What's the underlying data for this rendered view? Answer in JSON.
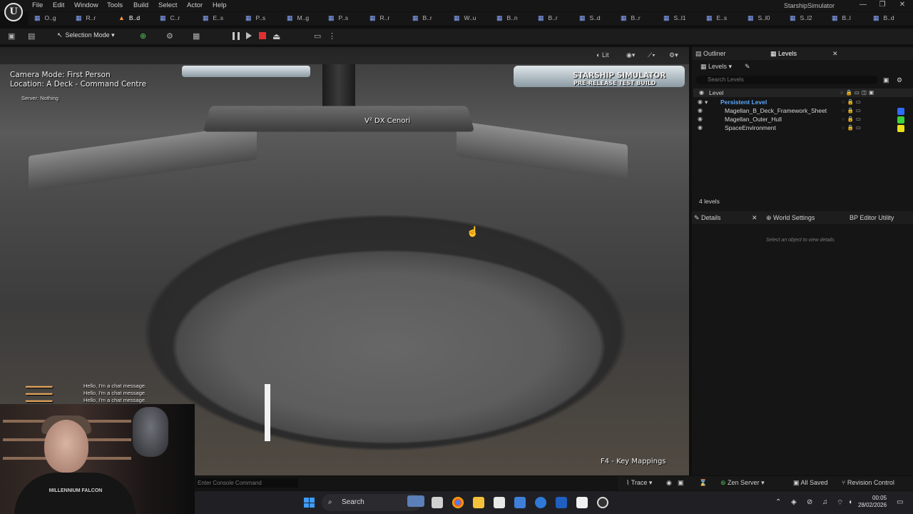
{
  "app": {
    "title": "StarshipSimulator",
    "logo_letter": "U"
  },
  "menu": [
    "File",
    "Edit",
    "Window",
    "Tools",
    "Build",
    "Select",
    "Actor",
    "Help"
  ],
  "window_controls": {
    "minimize": "—",
    "maximize": "❐",
    "close": "✕"
  },
  "tabs": [
    {
      "label": "O..g",
      "icon": "▦"
    },
    {
      "label": "R..r",
      "icon": "▦"
    },
    {
      "label": "B..d",
      "icon": "▲"
    },
    {
      "label": "C..r",
      "icon": "▦"
    },
    {
      "label": "E..s",
      "icon": "▦"
    },
    {
      "label": "P..s",
      "icon": "▦"
    },
    {
      "label": "M..g",
      "icon": "▦"
    },
    {
      "label": "P..s",
      "icon": "▦"
    },
    {
      "label": "R..r",
      "icon": "▦"
    },
    {
      "label": "B..r",
      "icon": "▦"
    },
    {
      "label": "W..u",
      "icon": "▦"
    },
    {
      "label": "B..n",
      "icon": "▦"
    },
    {
      "label": "B..r",
      "icon": "▦"
    },
    {
      "label": "S..d",
      "icon": "▦"
    },
    {
      "label": "B..r",
      "icon": "▦"
    },
    {
      "label": "S..l1",
      "icon": "▦"
    },
    {
      "label": "E..s",
      "icon": "▦"
    },
    {
      "label": "S..l0",
      "icon": "▦"
    },
    {
      "label": "S..l2",
      "icon": "▦"
    },
    {
      "label": "B..l",
      "icon": "▦"
    },
    {
      "label": "B..d",
      "icon": "▦"
    }
  ],
  "toolbar": {
    "selection_mode": "Selection Mode",
    "sel_arrow": "↖",
    "caret": "▾"
  },
  "viewport": {
    "lit_label": "Lit",
    "camera_mode": "Camera Mode: First Person",
    "location": "Location: A Deck - Command Centre",
    "server": "Server: Nothing",
    "brand_title": "STARSHIP SIMULATOR",
    "brand_sub": "PRE-RELEASE TEST BUILD",
    "console_label": "V² DX Cenori",
    "key_hint": "F4 - Key Mappings",
    "chat": [
      "Hello, I'm a chat message.",
      "Hello, I'm a chat message.",
      "Hello, I'm a chat message."
    ]
  },
  "webcam": {
    "shirt_text": "MILLENNIUM FALCON"
  },
  "console": {
    "placeholder": "Enter Console Command"
  },
  "status_bar": {
    "trace": "Trace",
    "zen_server": "Zen Server",
    "all_saved": "All Saved",
    "revision_control": "Revision Control"
  },
  "taskbar": {
    "search": "Search",
    "time": "00:05",
    "date": "28/02/2026"
  },
  "outliner": {
    "tab_outliner": "Outliner",
    "tab_levels": "Levels",
    "levels_dropdown": "Levels",
    "search_placeholder": "Search Levels",
    "column_level": "Level",
    "rows": [
      {
        "name": "Persistent Level",
        "color": ""
      },
      {
        "name": "Magellan_B_Deck_Framework_Sheet",
        "color": "#2f6bff"
      },
      {
        "name": "Magellan_Outer_Hull",
        "color": "#3ad13a"
      },
      {
        "name": "SpaceEnvironment",
        "color": "#e8e019"
      }
    ],
    "count": "4 levels"
  },
  "details": {
    "tab_details": "Details",
    "tab_world": "World Settings",
    "tab_bp": "BP Editor Utility",
    "empty": "Select an object to view details"
  }
}
